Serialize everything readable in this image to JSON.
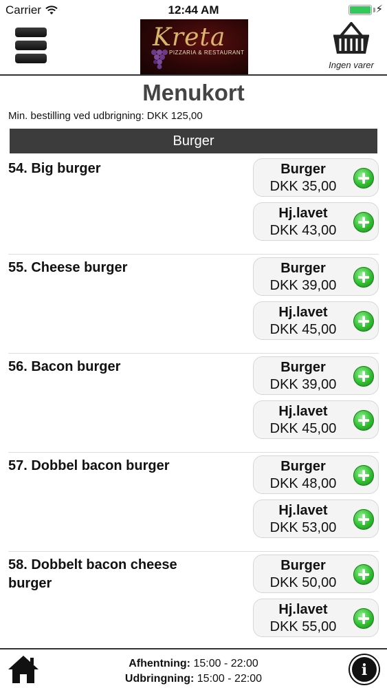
{
  "status_bar": {
    "carrier": "Carrier",
    "time": "12:44 AM",
    "battery_level": 1.0,
    "battery_color": "#34c759"
  },
  "header": {
    "menu_icon": "hamburger-icon",
    "logo_text": "Kreta",
    "logo_subtitle": "PIZZARIA & RESTAURANT",
    "cart_icon": "basket-icon",
    "cart_label": "Ingen varer"
  },
  "page": {
    "title": "Menukort",
    "min_order": "Min. bestilling ved udbrigning: DKK 125,00",
    "category": "Burger"
  },
  "items": [
    {
      "name": "54. Big burger",
      "options": [
        {
          "label": "Burger",
          "price": "DKK 35,00"
        },
        {
          "label": "Hj.lavet",
          "price": "DKK 43,00"
        }
      ]
    },
    {
      "name": "55. Cheese burger",
      "options": [
        {
          "label": "Burger",
          "price": "DKK 39,00"
        },
        {
          "label": "Hj.lavet",
          "price": "DKK 45,00"
        }
      ]
    },
    {
      "name": "56. Bacon burger",
      "options": [
        {
          "label": "Burger",
          "price": "DKK 39,00"
        },
        {
          "label": "Hj.lavet",
          "price": "DKK 45,00"
        }
      ]
    },
    {
      "name": "57. Dobbel bacon burger",
      "options": [
        {
          "label": "Burger",
          "price": "DKK 48,00"
        },
        {
          "label": "Hj.lavet",
          "price": "DKK 53,00"
        }
      ]
    },
    {
      "name": "58. Dobbelt bacon cheese burger",
      "options": [
        {
          "label": "Burger",
          "price": "DKK 50,00"
        },
        {
          "label": "Hj.lavet",
          "price": "DKK 55,00"
        }
      ]
    }
  ],
  "footer": {
    "home_icon": "home-icon",
    "pickup_label": "Afhentning:",
    "pickup_hours": "15:00 - 22:00",
    "delivery_label": "Udbringning:",
    "delivery_hours": "15:00 - 22:00",
    "info_icon": "info-icon"
  },
  "colors": {
    "category_bar": "#3c3c3c",
    "add_button": "#2fbf2f"
  }
}
